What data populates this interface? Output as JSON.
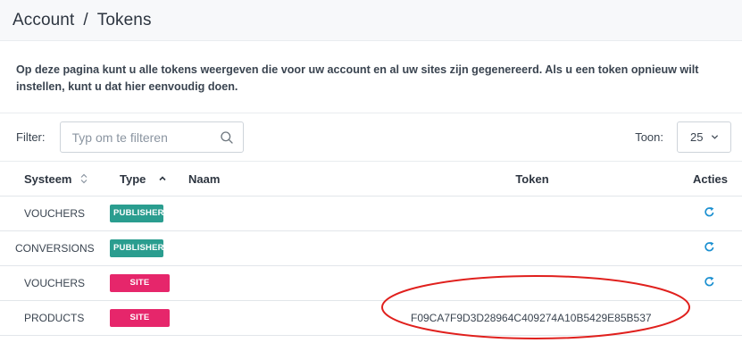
{
  "header": {
    "breadcrumb_root": "Account",
    "breadcrumb_separator": "/",
    "breadcrumb_current": "Tokens"
  },
  "description": "Op deze pagina kunt u alle tokens weergeven die voor uw account en al uw sites zijn gegenereerd. Als u een token opnieuw wilt instellen, kunt u dat hier eenvoudig doen.",
  "filter": {
    "label": "Filter:",
    "placeholder": "Typ om te filteren",
    "value": ""
  },
  "page_size": {
    "label": "Toon:",
    "selected": "25"
  },
  "table": {
    "columns": {
      "systeem": "Systeem",
      "type": "Type",
      "naam": "Naam",
      "token": "Token",
      "acties": "Acties"
    },
    "rows": [
      {
        "systeem": "VOUCHERS",
        "type": "PUBLISHER",
        "type_color": "#2a9d8f",
        "naam": "",
        "token": "",
        "action_icon": "refresh-icon"
      },
      {
        "systeem": "CONVERSIONS",
        "type": "PUBLISHER",
        "type_color": "#2a9d8f",
        "naam": "",
        "token": "",
        "action_icon": "refresh-icon"
      },
      {
        "systeem": "VOUCHERS",
        "type": "SITE",
        "type_color": "#e6266b",
        "naam": "",
        "token": "",
        "action_icon": "refresh-icon"
      },
      {
        "systeem": "PRODUCTS",
        "type": "SITE",
        "type_color": "#e6266b",
        "naam": "",
        "token": "F09CA7F9D3D28964C409274A10B5429E85B537",
        "action_icon": ""
      }
    ]
  },
  "colors": {
    "publisher": "#2a9d8f",
    "site": "#e6266b",
    "action": "#1a8fd0",
    "annotation": "#e0201d"
  }
}
